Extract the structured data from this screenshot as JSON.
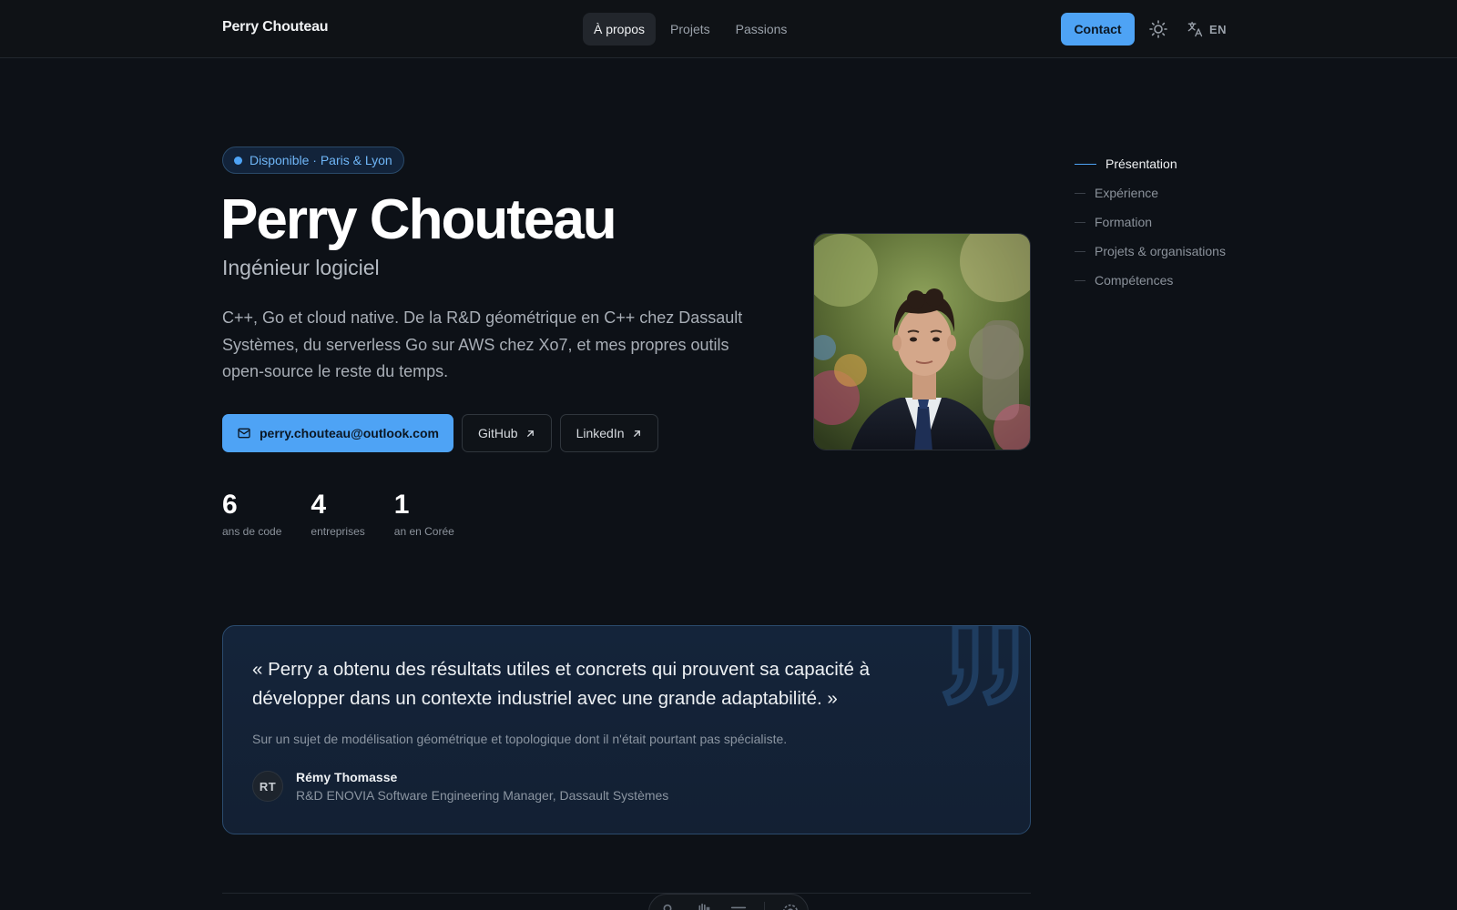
{
  "header": {
    "brand": "Perry Chouteau",
    "nav": [
      {
        "label": "À propos",
        "active": true
      },
      {
        "label": "Projets",
        "active": false
      },
      {
        "label": "Passions",
        "active": false
      }
    ],
    "contact_label": "Contact",
    "theme_icon": "sun-icon",
    "language": {
      "icon": "translate-icon",
      "label": "EN"
    }
  },
  "hero": {
    "badge": "Disponible · Paris & Lyon",
    "name": "Perry Chouteau",
    "role": "Ingénieur logiciel",
    "bio": "C++, Go et cloud native. De la R&D géométrique en C++ chez Dassault Systèmes, du serverless Go sur AWS chez Xo7, et mes propres outils open-source le reste du temps.",
    "email": "perry.chouteau@outlook.com",
    "github_label": "GitHub",
    "linkedin_label": "LinkedIn",
    "stats": [
      {
        "value": "6",
        "label": "ans de code"
      },
      {
        "value": "4",
        "label": "entreprises"
      },
      {
        "value": "1",
        "label": "an en Corée"
      }
    ]
  },
  "toc": [
    {
      "label": "Présentation",
      "active": true
    },
    {
      "label": "Expérience",
      "active": false
    },
    {
      "label": "Formation",
      "active": false
    },
    {
      "label": "Projets & organisations",
      "active": false
    },
    {
      "label": "Compétences",
      "active": false
    }
  ],
  "testimonial": {
    "quote": "« Perry a obtenu des résultats utiles et concrets qui prouvent sa capacité à développer dans un contexte industriel avec une grande adaptabilité. »",
    "context": "Sur un sujet de modélisation géométrique et topologique dont il n'était pourtant pas spécialiste.",
    "initials": "RT",
    "author": "Rémy Thomasse",
    "author_title": "R&D ENOVIA Software Engineering Manager, Dassault Systèmes"
  },
  "colors": {
    "background": "#0d1117",
    "accent": "#4ea3f5",
    "quote_card": "#14243a"
  }
}
